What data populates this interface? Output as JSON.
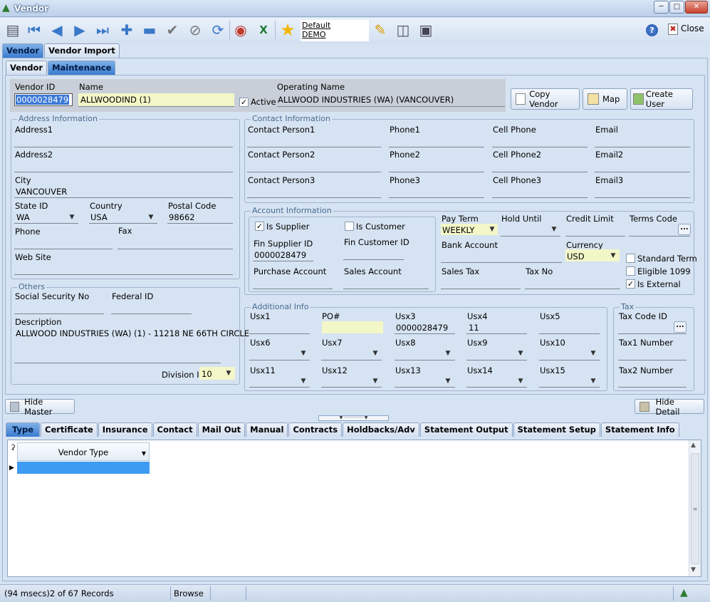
{
  "window": {
    "title": "Vendor"
  },
  "toolbar": {
    "default_line1": "Default",
    "default_line2": "DEMO",
    "close_label": "Close",
    "help_label": "?"
  },
  "main_tabs": [
    "Vendor",
    "Vendor Import"
  ],
  "sub_tabs": [
    "Vendor",
    "Maintenance"
  ],
  "header": {
    "vendor_id_label": "Vendor ID",
    "vendor_id": "0000028479",
    "name_label": "Name",
    "name": "ALLWOODIND (1)",
    "active_label": "Active",
    "operating_name_label": "Operating Name",
    "operating_name": "ALLWOOD INDUSTRIES (WA) (VANCOUVER)",
    "copy_vendor": "Copy Vendor",
    "map": "Map",
    "create_user": "Create User"
  },
  "address": {
    "title": "Address Information",
    "address1_label": "Address1",
    "address2_label": "Address2",
    "city_label": "City",
    "city": "VANCOUVER",
    "state_label": "State ID",
    "state": "WA",
    "country_label": "Country",
    "country": "USA",
    "postal_label": "Postal Code",
    "postal": "98662",
    "phone_label": "Phone",
    "fax_label": "Fax",
    "website_label": "Web Site"
  },
  "others": {
    "title": "Others",
    "ssn_label": "Social Security No",
    "federal_label": "Federal  ID",
    "description_label": "Description",
    "description": "ALLWOOD INDUSTRIES (WA)  (1) - 11218 NE 66TH CIRCLE",
    "division_label": "Division ID",
    "division": "10"
  },
  "contact": {
    "title": "Contact Information",
    "labels": [
      "Contact Person1",
      "Phone1",
      "Cell Phone",
      "Email",
      "Contact Person2",
      "Phone2",
      "Cell Phone2",
      "Email2",
      "Contact Person3",
      "Phone3",
      "Cell Phone3",
      "Email3"
    ]
  },
  "account": {
    "title": "Account Information",
    "is_supplier": "Is Supplier",
    "is_customer": "Is Customer",
    "fin_supplier_label": "Fin Supplier ID",
    "fin_supplier": "0000028479",
    "fin_customer_label": "Fin Customer ID",
    "purchase_account": "Purchase Account",
    "sales_account": "Sales Account",
    "pay_term_label": "Pay Term",
    "pay_term": "WEEKLY",
    "hold_until_label": "Hold Until",
    "credit_limit_label": "Credit Limit",
    "terms_code_label": "Terms Code",
    "bank_account_label": "Bank Account",
    "currency_label": "Currency",
    "currency": "USD",
    "sales_tax_label": "Sales Tax",
    "tax_no_label": "Tax No",
    "standard_term": "Standard Term",
    "eligible_1099": "Eligible 1099",
    "is_external": "Is External"
  },
  "additional": {
    "title": "Additional Info",
    "usx1": "Usx1",
    "po": "PO#",
    "usx3": "Usx3",
    "usx3_val": "0000028479",
    "usx4": "Usx4",
    "usx4_val": "11",
    "usx5": "Usx5",
    "usx6": "Usx6",
    "usx7": "Usx7",
    "usx8": "Usx8",
    "usx9": "Usx9",
    "usx10": "Usx10",
    "usx11": "Usx11",
    "usx12": "Usx12",
    "usx13": "Usx13",
    "usx14": "Usx14",
    "usx15": "Usx15"
  },
  "tax": {
    "title": "Tax",
    "tax_code_label": "Tax Code ID",
    "tax1_label": "Tax1 Number",
    "tax2_label": "Tax2 Number"
  },
  "hide_master": "Hide Master",
  "hide_detail": "Hide Detail",
  "detail_tabs": [
    "Type",
    "Certificate",
    "Insurance",
    "Contact",
    "Mail Out",
    "Manual",
    "Contracts",
    "Holdbacks/Adv",
    "Statement Output",
    "Statement Setup",
    "Statement Info"
  ],
  "grid": {
    "column_header": "Vendor Type"
  },
  "status": {
    "records": "(94 msecs)2 of 67 Records",
    "mode": "Browse"
  }
}
